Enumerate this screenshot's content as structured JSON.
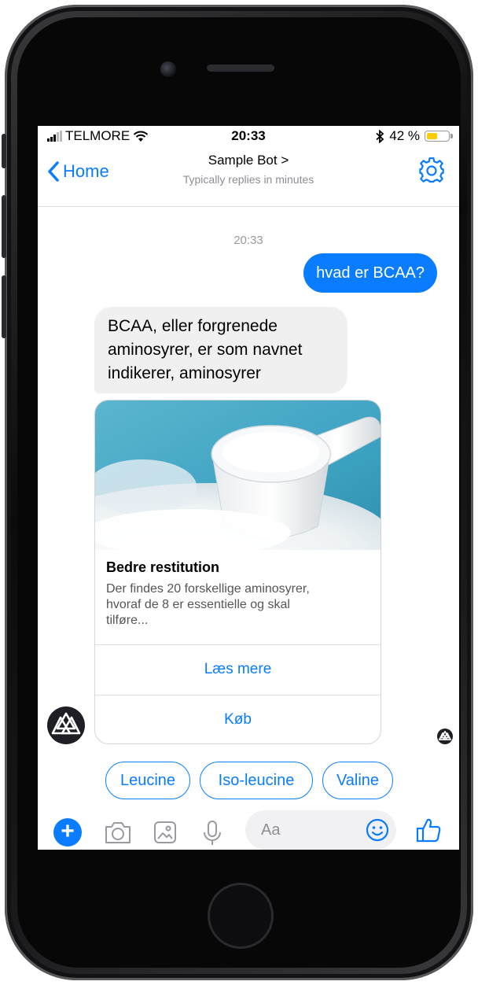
{
  "status_bar": {
    "carrier": "TELMORE",
    "time": "20:33",
    "battery_text": "42 %",
    "battery_level": 0.42
  },
  "nav": {
    "back_label": "Home",
    "title": "Sample Bot >",
    "subtitle": "Typically replies in minutes"
  },
  "conversation": {
    "timestamp": "20:33",
    "user_message": "hvad er BCAA?",
    "bot_message_lines": [
      "BCAA, eller forgrenede",
      "aminosyrer, er som navnet",
      "indikerer, aminosyrer"
    ],
    "card": {
      "title": "Bedre restitution",
      "subtitle_lines": [
        "Der findes 20 forskellige aminosyrer,",
        "hvoraf de 8 er essentielle og skal",
        "tilføre..."
      ],
      "button_1": "Læs mere",
      "button_2": "Køb"
    }
  },
  "quick_replies": [
    "Leucine",
    "Iso-leucine",
    "Valine"
  ],
  "composer": {
    "placeholder": "Aa"
  },
  "colors": {
    "accent": "#0a7cff",
    "incoming_bubble": "#f0f0f0",
    "battery": "#ffcc00"
  },
  "icons": [
    "chevron-left-icon",
    "gear-icon",
    "camera-icon",
    "image-icon",
    "microphone-icon",
    "smile-icon",
    "thumbs-up-icon",
    "plus-icon",
    "bluetooth-icon",
    "wifi-icon"
  ]
}
